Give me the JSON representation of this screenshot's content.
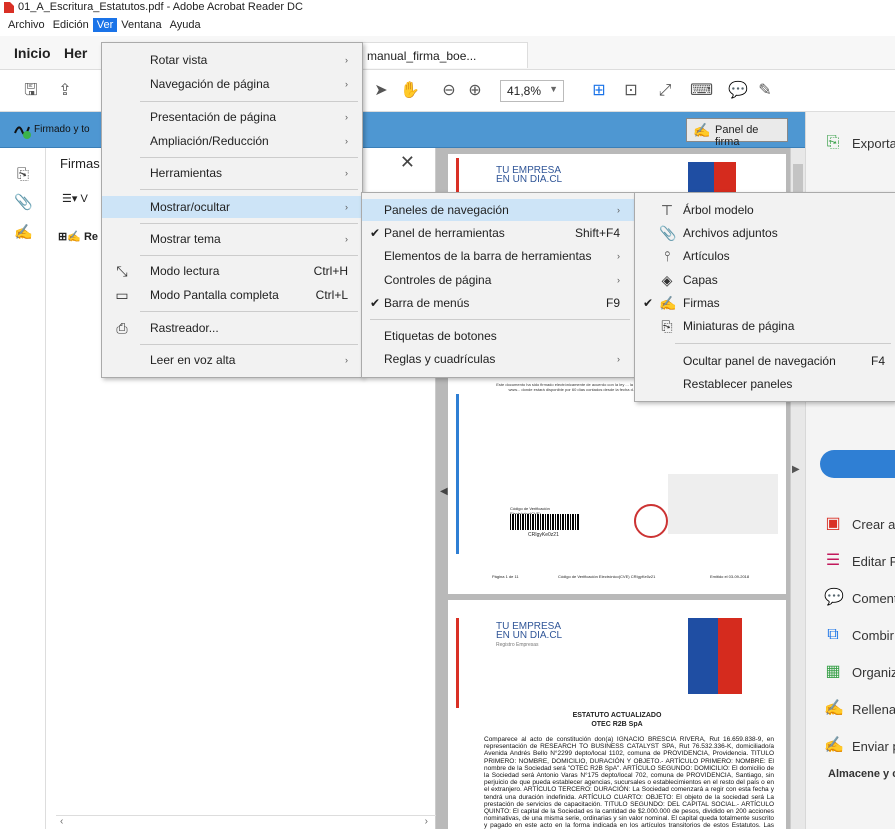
{
  "window": {
    "title": "01_A_Escritura_Estatutos.pdf - Adobe Acrobat Reader DC"
  },
  "menubar": [
    "Archivo",
    "Edición",
    "Ver",
    "Ventana",
    "Ayuda"
  ],
  "tabs": {
    "home": "Inicio",
    "tools": "Her",
    "doc": "manual_firma_boe..."
  },
  "toolbar": {
    "zoom": "41,8%"
  },
  "sigbar": {
    "text": "Firmado y to",
    "panel_btn": "Panel de firma"
  },
  "firmas_panel": {
    "title": "Firmas",
    "options": "V",
    "item": "Re"
  },
  "ver_menu": [
    {
      "label": "Rotar vista",
      "arrow": "›"
    },
    {
      "label": "Navegación de página",
      "arrow": "›"
    },
    {
      "label": "Presentación de página",
      "arrow": "›"
    },
    {
      "label": "Ampliación/Reducción",
      "arrow": "›"
    },
    {
      "label": "Herramientas",
      "arrow": "›"
    },
    {
      "label": "Mostrar/ocultar",
      "arrow": "›"
    },
    {
      "label": "Mostrar tema",
      "arrow": "›"
    },
    {
      "label": "Modo lectura",
      "shortcut": "Ctrl+H"
    },
    {
      "label": "Modo Pantalla completa",
      "shortcut": "Ctrl+L"
    },
    {
      "label": "Rastreador..."
    },
    {
      "label": "Leer en voz alta",
      "arrow": "›"
    }
  ],
  "mostrar_menu": [
    {
      "label": "Paneles de navegación",
      "arrow": "›"
    },
    {
      "label": "Panel de herramientas",
      "shortcut": "Shift+F4",
      "checked": "✔"
    },
    {
      "label": "Elementos de la barra de herramientas",
      "arrow": "›"
    },
    {
      "label": "Controles de página",
      "arrow": "›"
    },
    {
      "label": "Barra de menús",
      "shortcut": "F9",
      "checked": "✔"
    },
    {
      "label": "Etiquetas de botones"
    },
    {
      "label": "Reglas y cuadrículas",
      "arrow": "›"
    }
  ],
  "paneles_menu": [
    {
      "label": "Árbol modelo"
    },
    {
      "label": "Archivos adjuntos"
    },
    {
      "label": "Artículos"
    },
    {
      "label": "Capas"
    },
    {
      "label": "Firmas",
      "checked": "✔"
    },
    {
      "label": "Miniaturas de página"
    },
    {
      "label": "Ocultar panel de navegación",
      "shortcut": "F4"
    },
    {
      "label": "Restablecer paneles"
    }
  ],
  "document": {
    "brand": "TU EMPRESA EN UN DIA.CL",
    "brand_sub": "Registro Empresas",
    "cve_label": "Código de Verificación Electrónico(CVE)",
    "cve_code": "CRIgyKe0z21",
    "footer_left": "Página 1 de 11",
    "footer_mid": "Código de Verificación Electrónico(CVE) CRIgyKe0z21",
    "footer_right": "Emitido el 03-09-2018",
    "notice": "Este documento ha sido firmado electrónicamente de acuerdo con la ley ... la integridad y autenticidad de este documento puede consultar en www... donde estará disponible por 60 días contados desde la fecha d... El documento impreso es copia del documento original.",
    "heading1": "ESTATUTO ACTUALIZADO",
    "heading2": "OTEC R2B SpA",
    "body": "Comparece al acto de constitución don(a) IGNACIO BRESCIA RIVERA, Rut 16.659.838-9, en representación de RESEARCH TO BUSINESS CATALYST SPA, Rut 76.532.336-K, domiciliado/a Avenida Andrés Bello N°2299 depto/local 1102, comuna de PROVIDENCIA, Providencia. TITULO PRIMERO: NOMBRE, DOMICILIO, DURACIÓN Y OBJETO.- ARTÍCULO PRIMERO: NOMBRE: El nombre de la Sociedad será \"OTEC R2B SpA\". ARTÍCULO SEGUNDO: DOMICILIO: El domicilio de la Sociedad será Antonio Varas N°175 depto/local 702, comuna de PROVIDENCIA, Santiago, sin perjuicio de que pueda establecer agencias, sucursales o establecimientos en el resto del país o en el extranjero. ARTÍCULO TERCERO: DURACIÓN: La Sociedad comenzará a regir con esta fecha y tendrá una duración indefinida. ARTÍCULO CUARTO: OBJETO: El objeto de la sociedad será La prestación de servicios de capacitación. TITULO SEGUNDO: DEL CAPITAL SOCIAL.- ARTÍCULO QUINTO: El capital de la Sociedad es la cantidad de $2.000.000 de pesos, dividido en 200 acciones nominativas, de una misma serie, ordinarias y sin valor nominal. El capital queda totalmente suscrito y pagado en este acto en la forma indicada en los artículos transitorios de estos Estatutos. Las acciones"
  },
  "right_panel": {
    "items": [
      "Exporta",
      "Crear a",
      "Editar P",
      "Coment",
      "Combir",
      "Organiz",
      "Rellena",
      "Enviar p"
    ],
    "footer": "Almacene y c"
  },
  "colors": {
    "accent": "#1a73e8",
    "sigbar": "#4e97d2",
    "highlight": "#cde4f7",
    "red": "#d93025",
    "blue_btn": "#2f7fd4"
  }
}
